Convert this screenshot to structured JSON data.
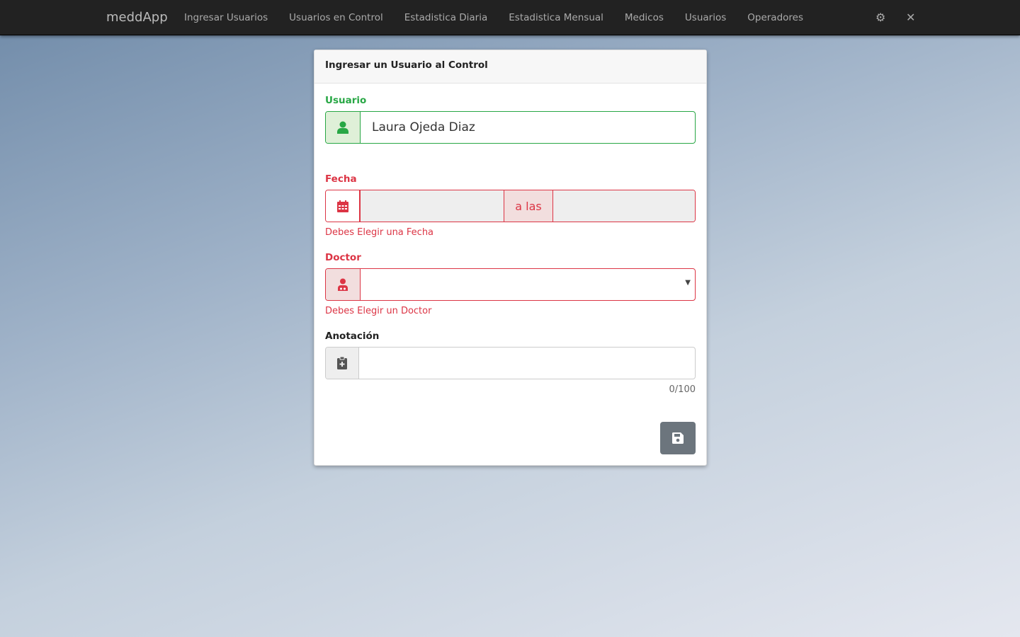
{
  "nav": {
    "brand": "meddApp",
    "links": [
      "Ingresar Usuarios",
      "Usuarios en Control",
      "Estadistica Diaria",
      "Estadistica Mensual",
      "Medicos",
      "Usuarios",
      "Operadores"
    ],
    "settings_icon": "⚙",
    "close_icon": "✕"
  },
  "form": {
    "title": "Ingresar un Usuario al Control",
    "usuario": {
      "label": "Usuario",
      "value": "Laura Ojeda Diaz"
    },
    "fecha": {
      "label": "Fecha",
      "separator": "a las",
      "error": "Debes Elegir una Fecha"
    },
    "doctor": {
      "label": "Doctor",
      "error": "Debes Elegir un Doctor"
    },
    "anotacion": {
      "label": "Anotación",
      "counter": "0/100"
    }
  },
  "colors": {
    "valid": "#28a745",
    "invalid": "#dc3545",
    "button": "#6c757d"
  }
}
